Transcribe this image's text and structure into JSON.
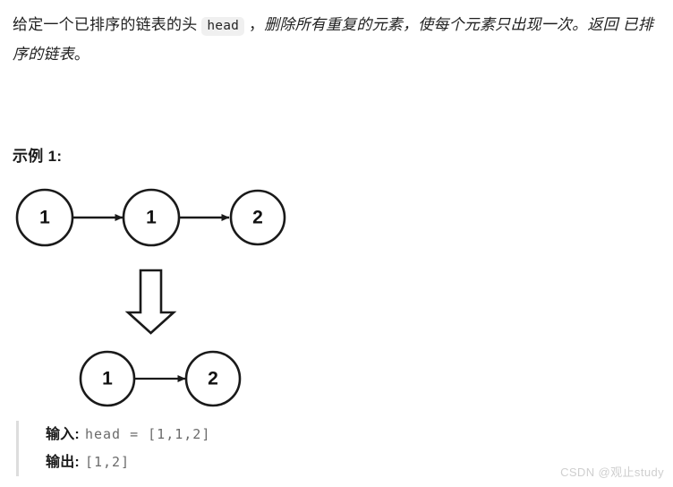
{
  "statement": {
    "part1": "给定一个已排序的链表的头 ",
    "code": "head",
    "part2": " ，",
    "emphasis": "删除所有重复的元素，使每个元素只出现一次。返回 ",
    "emphasis2": "已排序的链表",
    "part3": "。"
  },
  "example": {
    "heading": "示例 1:"
  },
  "diagram": {
    "row1": {
      "nodes": [
        "1",
        "1",
        "2"
      ]
    },
    "row2": {
      "nodes": [
        "1",
        "2"
      ]
    },
    "transform_arrow": "down-block-arrow"
  },
  "io": {
    "input_label": "输入:",
    "input_value": "head = [1,1,2]",
    "output_label": "输出:",
    "output_value": "[1,2]"
  },
  "watermark": {
    "text": "CSDN @观止study"
  },
  "colors": {
    "text": "#1f1f1f",
    "code_badge_bg": "#f0f0f0",
    "code_value": "#6b6b6b",
    "blockquote_border": "#dddddd",
    "node_stroke": "#1a1a1a",
    "watermark": "#cfcfcf"
  }
}
